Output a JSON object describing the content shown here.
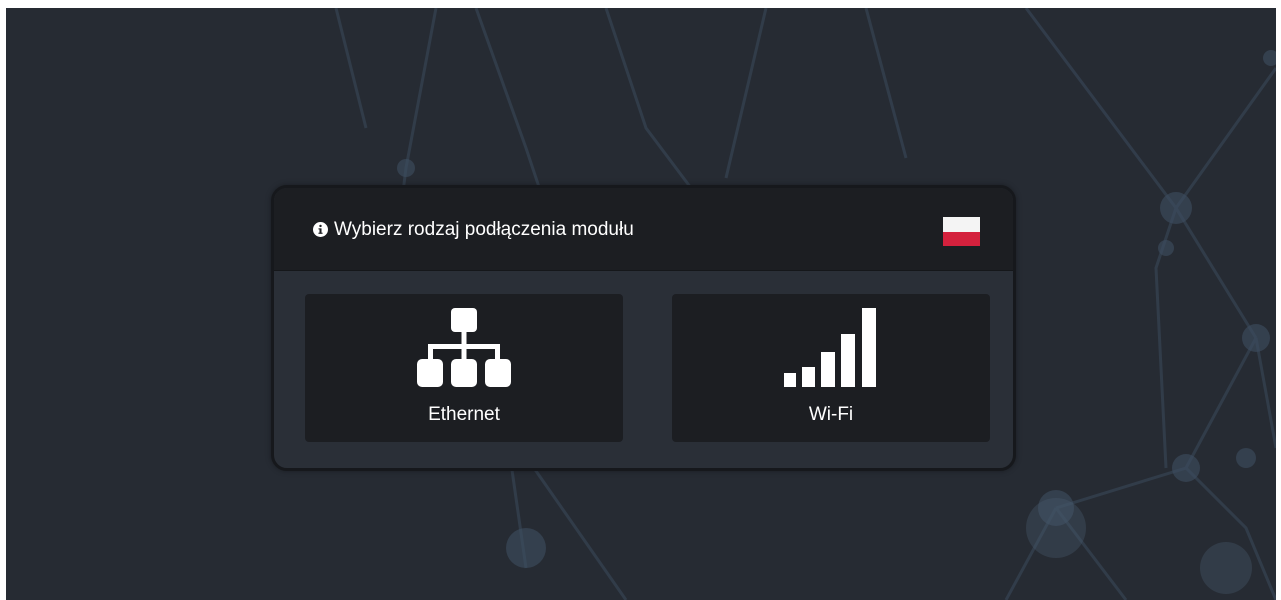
{
  "dialog": {
    "title": "Wybierz rodzaj podłączenia modułu",
    "info_icon": "info-circle-icon",
    "language_flag": "flag-poland-icon"
  },
  "options": [
    {
      "label": "Ethernet",
      "icon": "network-sitemap-icon"
    },
    {
      "label": "Wi-Fi",
      "icon": "signal-bars-icon"
    }
  ],
  "colors": {
    "background": "#262b33",
    "dialog_body": "#2a2f37",
    "dialog_header": "#1c1e22",
    "option_tile": "#1c1e22",
    "text": "#ffffff",
    "flag_white": "#f4f4f4",
    "flag_red": "#d4213d"
  }
}
